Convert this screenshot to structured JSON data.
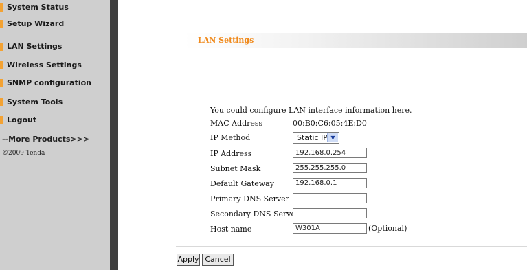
{
  "sidebar": {
    "items": [
      {
        "label": "System Status"
      },
      {
        "label": "Setup Wizard"
      },
      {
        "label": "LAN Settings"
      },
      {
        "label": "Wireless Settings"
      },
      {
        "label": "SNMP configuration"
      },
      {
        "label": "System Tools"
      },
      {
        "label": "Logout"
      }
    ],
    "more_products": "--More Products>>>",
    "copyright": "©2009 Tenda",
    "marker_color": "#f3a233"
  },
  "panel": {
    "title": "LAN Settings",
    "intro": "You could configure LAN interface information here.",
    "mac_label": "MAC Address",
    "mac_value": "00:B0:C6:05:4E:D0",
    "ip_method_label": "IP Method",
    "ip_method_value": "Static IP",
    "ip_address_label": "IP Address",
    "ip_address_value": "192.168.0.254",
    "subnet_label": "Subnet Mask",
    "subnet_value": "255.255.255.0",
    "gateway_label": "Default Gateway",
    "gateway_value": "192.168.0.1",
    "primary_dns_label": "Primary DNS Server",
    "primary_dns_value": "",
    "secondary_dns_label": "Secondary DNS Server",
    "secondary_dns_value": "",
    "host_label": "Host name",
    "host_value": "W301A",
    "host_optional": "(Optional)"
  },
  "buttons": {
    "apply": "Apply",
    "cancel": "Cancel"
  },
  "colors": {
    "accent": "#f08a1c",
    "sidebar_bg": "#cfcfcf",
    "divider": "#3f3f3f"
  },
  "icons": {
    "dropdown_arrow": "chevron-down-icon"
  }
}
